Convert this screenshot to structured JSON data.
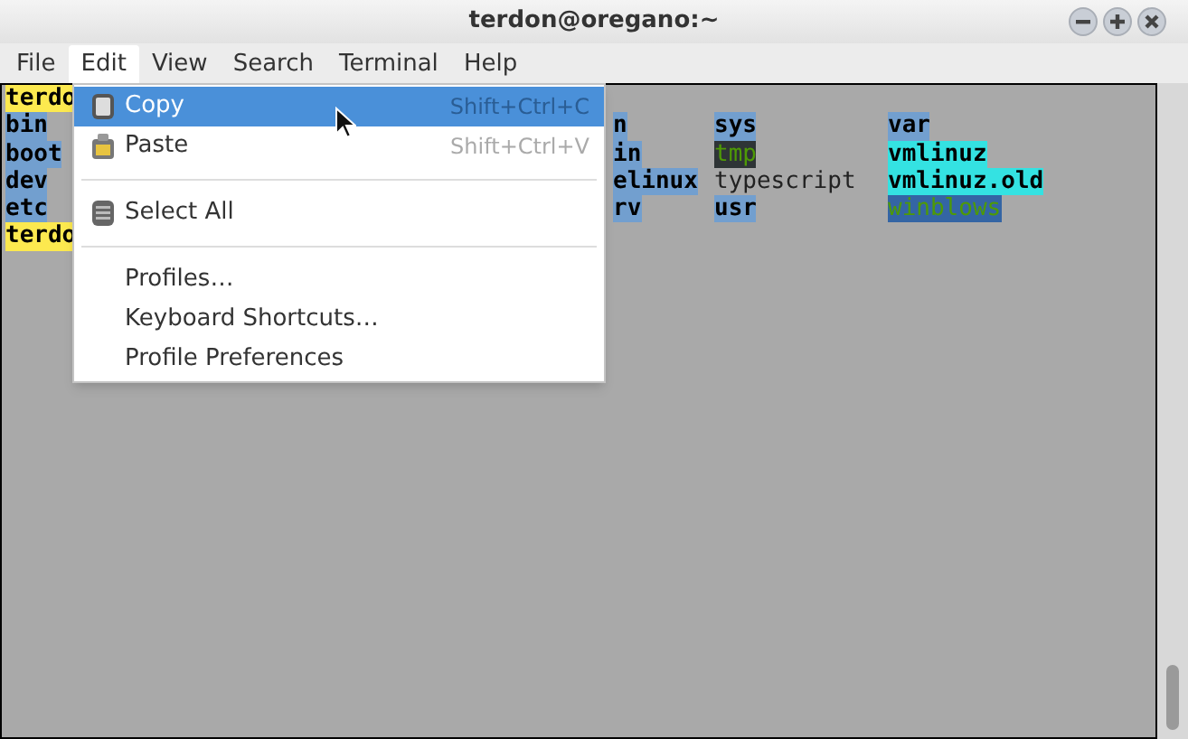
{
  "window": {
    "title": "terdon@oregano:~"
  },
  "menubar": [
    {
      "label": "File",
      "selected": false
    },
    {
      "label": "Edit",
      "selected": true
    },
    {
      "label": "View",
      "selected": false
    },
    {
      "label": "Search",
      "selected": false
    },
    {
      "label": "Terminal",
      "selected": false
    },
    {
      "label": "Help",
      "selected": false
    }
  ],
  "edit_menu": [
    {
      "kind": "copy",
      "label": "Copy",
      "shortcut": "Shift+Ctrl+C",
      "selected": true
    },
    {
      "kind": "paste",
      "label": "Paste",
      "shortcut": "Shift+Ctrl+V",
      "selected": false
    },
    {
      "kind": "separator"
    },
    {
      "kind": "select_all",
      "label": "Select All",
      "selected": false
    },
    {
      "kind": "separator"
    },
    {
      "kind": "plain",
      "label": "Profiles…",
      "selected": false
    },
    {
      "kind": "plain",
      "label": "Keyboard Shortcuts…",
      "selected": false
    },
    {
      "kind": "plain",
      "label": "Profile Preferences",
      "selected": false
    }
  ],
  "terminal_lines": [
    [
      {
        "kind": "prompt",
        "text": "terdo"
      }
    ],
    [
      {
        "kind": "dir",
        "text": "bin"
      },
      {
        "kind": "dir",
        "text": "n"
      },
      {
        "kind": "dir",
        "text": "sys"
      },
      {
        "kind": "dir",
        "text": "var"
      }
    ],
    [
      {
        "kind": "dir",
        "text": "boot"
      },
      {
        "kind": "dir",
        "text": "in"
      },
      {
        "kind": "sticky",
        "text": "tmp"
      },
      {
        "kind": "link",
        "text": "vmlinuz"
      }
    ],
    [
      {
        "kind": "dir",
        "text": "dev"
      },
      {
        "kind": "dir",
        "text": "elinux"
      },
      {
        "kind": "file",
        "text": "typescript"
      },
      {
        "kind": "link",
        "text": "vmlinuz.old"
      }
    ],
    [
      {
        "kind": "dir",
        "text": "etc"
      },
      {
        "kind": "dir",
        "text": "rv"
      },
      {
        "kind": "dir",
        "text": "usr"
      },
      {
        "kind": "writable",
        "text": "winblows"
      }
    ],
    [
      {
        "kind": "prompt",
        "text": "terdo"
      }
    ]
  ]
}
